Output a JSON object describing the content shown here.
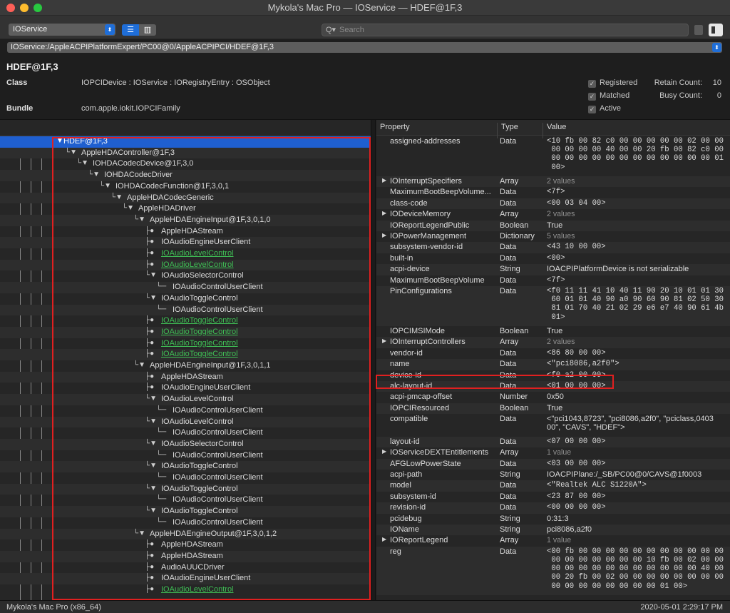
{
  "window": {
    "title": "Mykola's Mac Pro — IOService — HDEF@1F,3"
  },
  "toolbar": {
    "plane": "IOService",
    "search_placeholder": "Search",
    "list_icon": "☰",
    "columns_icon": "▥",
    "search_icon": "Q▾"
  },
  "path": "IOService:/AppleACPIPlatformExpert/PC00@0/AppleACPIPCI/HDEF@1F,3",
  "object": {
    "title": "HDEF@1F,3",
    "class_label": "Class",
    "class_value": "IOPCIDevice : IOService : IORegistryEntry : OSObject",
    "bundle_label": "Bundle",
    "bundle_value": "com.apple.iokit.IOPCIFamily",
    "flags": [
      {
        "label": "Registered",
        "checked": true
      },
      {
        "label": "Matched",
        "checked": true
      },
      {
        "label": "Active",
        "checked": true
      }
    ],
    "retain_label": "Retain Count:",
    "retain_value": "10",
    "busy_label": "Busy Count:",
    "busy_value": "0"
  },
  "tree": [
    {
      "label": "HDEF@1F,3",
      "depth": 0,
      "kind": "open",
      "selected": true
    },
    {
      "label": "AppleHDAController@1F,3",
      "depth": 1,
      "kind": "open"
    },
    {
      "label": "IOHDACodecDevice@1F,3,0",
      "depth": 2,
      "kind": "open"
    },
    {
      "label": "IOHDACodecDriver",
      "depth": 3,
      "kind": "open"
    },
    {
      "label": "IOHDACodecFunction@1F,3,0,1",
      "depth": 4,
      "kind": "open"
    },
    {
      "label": "AppleHDACodecGeneric",
      "depth": 5,
      "kind": "open"
    },
    {
      "label": "AppleHDADriver",
      "depth": 6,
      "kind": "open"
    },
    {
      "label": "AppleHDAEngineInput@1F,3,0,1,0",
      "depth": 7,
      "kind": "open"
    },
    {
      "label": "AppleHDAStream",
      "depth": 8,
      "kind": "leaf"
    },
    {
      "label": "IOAudioEngineUserClient",
      "depth": 8,
      "kind": "leaf"
    },
    {
      "label": "IOAudioLevelControl",
      "depth": 8,
      "kind": "leaf",
      "green": true
    },
    {
      "label": "IOAudioLevelControl",
      "depth": 8,
      "kind": "leaf",
      "green": true
    },
    {
      "label": "IOAudioSelectorControl",
      "depth": 8,
      "kind": "open"
    },
    {
      "label": "IOAudioControlUserClient",
      "depth": 9,
      "kind": "end"
    },
    {
      "label": "IOAudioToggleControl",
      "depth": 8,
      "kind": "open"
    },
    {
      "label": "IOAudioControlUserClient",
      "depth": 9,
      "kind": "end"
    },
    {
      "label": "IOAudioToggleControl",
      "depth": 8,
      "kind": "leaf",
      "green": true
    },
    {
      "label": "IOAudioToggleControl",
      "depth": 8,
      "kind": "leaf",
      "green": true
    },
    {
      "label": "IOAudioToggleControl",
      "depth": 8,
      "kind": "leaf",
      "green": true
    },
    {
      "label": "IOAudioToggleControl",
      "depth": 8,
      "kind": "leaf",
      "green": true
    },
    {
      "label": "AppleHDAEngineInput@1F,3,0,1,1",
      "depth": 7,
      "kind": "open"
    },
    {
      "label": "AppleHDAStream",
      "depth": 8,
      "kind": "leaf"
    },
    {
      "label": "IOAudioEngineUserClient",
      "depth": 8,
      "kind": "leaf"
    },
    {
      "label": "IOAudioLevelControl",
      "depth": 8,
      "kind": "open"
    },
    {
      "label": "IOAudioControlUserClient",
      "depth": 9,
      "kind": "end"
    },
    {
      "label": "IOAudioLevelControl",
      "depth": 8,
      "kind": "open"
    },
    {
      "label": "IOAudioControlUserClient",
      "depth": 9,
      "kind": "end"
    },
    {
      "label": "IOAudioSelectorControl",
      "depth": 8,
      "kind": "open"
    },
    {
      "label": "IOAudioControlUserClient",
      "depth": 9,
      "kind": "end"
    },
    {
      "label": "IOAudioToggleControl",
      "depth": 8,
      "kind": "open"
    },
    {
      "label": "IOAudioControlUserClient",
      "depth": 9,
      "kind": "end"
    },
    {
      "label": "IOAudioToggleControl",
      "depth": 8,
      "kind": "open"
    },
    {
      "label": "IOAudioControlUserClient",
      "depth": 9,
      "kind": "end"
    },
    {
      "label": "IOAudioToggleControl",
      "depth": 8,
      "kind": "open"
    },
    {
      "label": "IOAudioControlUserClient",
      "depth": 9,
      "kind": "end"
    },
    {
      "label": "AppleHDAEngineOutput@1F,3,0,1,2",
      "depth": 7,
      "kind": "open"
    },
    {
      "label": "AppleHDAStream",
      "depth": 8,
      "kind": "leaf"
    },
    {
      "label": "AppleHDAStream",
      "depth": 8,
      "kind": "leaf"
    },
    {
      "label": "AudioAUUCDriver",
      "depth": 8,
      "kind": "leaf"
    },
    {
      "label": "IOAudioEngineUserClient",
      "depth": 8,
      "kind": "leaf"
    },
    {
      "label": "IOAudioLevelControl",
      "depth": 8,
      "kind": "leaf",
      "green": true
    }
  ],
  "props_header": {
    "property": "Property",
    "type": "Type",
    "value": "Value"
  },
  "props": [
    {
      "name": "assigned-addresses",
      "type": "Data",
      "value": "<10 fb 00 82 c0 00 00 00 00 00 02 00 00\n 00 00 00 00 40 00 00 20 fb 00 82 c0 00\n 00 00 00 00 00 00 00 00 00 00 00 00 01\n 00>",
      "lines": 4
    },
    {
      "name": "IOInterruptSpecifiers",
      "type": "Array",
      "value": "2 values",
      "dim": true,
      "expand": true
    },
    {
      "name": "MaximumBootBeepVolume...",
      "type": "Data",
      "value": "<7f>"
    },
    {
      "name": "class-code",
      "type": "Data",
      "value": "<00 03 04 00>"
    },
    {
      "name": "IODeviceMemory",
      "type": "Array",
      "value": "2 values",
      "dim": true,
      "expand": true
    },
    {
      "name": "IOReportLegendPublic",
      "type": "Boolean",
      "value": "True",
      "txt": true
    },
    {
      "name": "IOPowerManagement",
      "type": "Dictionary",
      "value": "5 values",
      "dim": true,
      "expand": true
    },
    {
      "name": "subsystem-vendor-id",
      "type": "Data",
      "value": "<43 10 00 00>"
    },
    {
      "name": "built-in",
      "type": "Data",
      "value": "<00>"
    },
    {
      "name": "acpi-device",
      "type": "String",
      "value": "IOACPIPlatformDevice is not serializable",
      "txt": true
    },
    {
      "name": "MaximumBootBeepVolume",
      "type": "Data",
      "value": "<7f>"
    },
    {
      "name": "PinConfigurations",
      "type": "Data",
      "value": "<f0 11 11 41 10 40 11 90 20 10 01 01 30\n 60 01 01 40 90 a0 90 60 90 81 02 50 30\n 81 01 70 40 21 02 29 e6 e7 40 90 61 4b\n 01>",
      "lines": 4
    },
    {
      "name": "IOPCIMSIMode",
      "type": "Boolean",
      "value": "True",
      "txt": true
    },
    {
      "name": "IOInterruptControllers",
      "type": "Array",
      "value": "2 values",
      "dim": true,
      "expand": true
    },
    {
      "name": "vendor-id",
      "type": "Data",
      "value": "<86 80 00 00>"
    },
    {
      "name": "name",
      "type": "Data",
      "value": "<\"pci8086,a2f0\">"
    },
    {
      "name": "device-id",
      "type": "Data",
      "value": "<f0 a2 00 00>"
    },
    {
      "name": "alc-layout-id",
      "type": "Data",
      "value": "<01 00 00 00>"
    },
    {
      "name": "acpi-pmcap-offset",
      "type": "Number",
      "value": "0x50",
      "txt": true
    },
    {
      "name": "IOPCIResourced",
      "type": "Boolean",
      "value": "True",
      "txt": true
    },
    {
      "name": "compatible",
      "type": "Data",
      "value": "<\"pci1043,8723\", \"pci8086,a2f0\", \"pciclass,0403\n00\", \"CAVS\", \"HDEF\">",
      "lines": 2,
      "txt": true
    },
    {
      "name": "layout-id",
      "type": "Data",
      "value": "<07 00 00 00>"
    },
    {
      "name": "IOServiceDEXTEntitlements",
      "type": "Array",
      "value": "1 value",
      "dim": true,
      "expand": true
    },
    {
      "name": "AFGLowPowerState",
      "type": "Data",
      "value": "<03 00 00 00>"
    },
    {
      "name": "acpi-path",
      "type": "String",
      "value": "IOACPIPlane:/_SB/PC00@0/CAVS@1f0003",
      "txt": true
    },
    {
      "name": "model",
      "type": "Data",
      "value": "<\"Realtek ALC S1220A\">"
    },
    {
      "name": "subsystem-id",
      "type": "Data",
      "value": "<23 87 00 00>"
    },
    {
      "name": "revision-id",
      "type": "Data",
      "value": "<00 00 00 00>"
    },
    {
      "name": "pcidebug",
      "type": "String",
      "value": "0:31:3",
      "txt": true
    },
    {
      "name": "IOName",
      "type": "String",
      "value": "pci8086,a2f0",
      "txt": true
    },
    {
      "name": "IOReportLegend",
      "type": "Array",
      "value": "1 value",
      "dim": true,
      "expand": true
    },
    {
      "name": "reg",
      "type": "Data",
      "value": "<00 fb 00 00 00 00 00 00 00 00 00 00 00\n 00 00 00 00 00 00 00 10 fb 00 02 00 00\n 00 00 00 00 00 00 00 00 00 00 00 40 00\n 00 20 fb 00 02 00 00 00 00 00 00 00 00\n 00 00 00 00 00 00 00 00 01 00>",
      "lines": 5
    }
  ],
  "status": {
    "left": "Mykola's Mac Pro (x86_64)",
    "right": "2020-05-01 2:29:17 PM"
  },
  "colors": {
    "selection": "#1f5fd0",
    "highlight": "#e02020",
    "green_link": "#3fbf55"
  }
}
